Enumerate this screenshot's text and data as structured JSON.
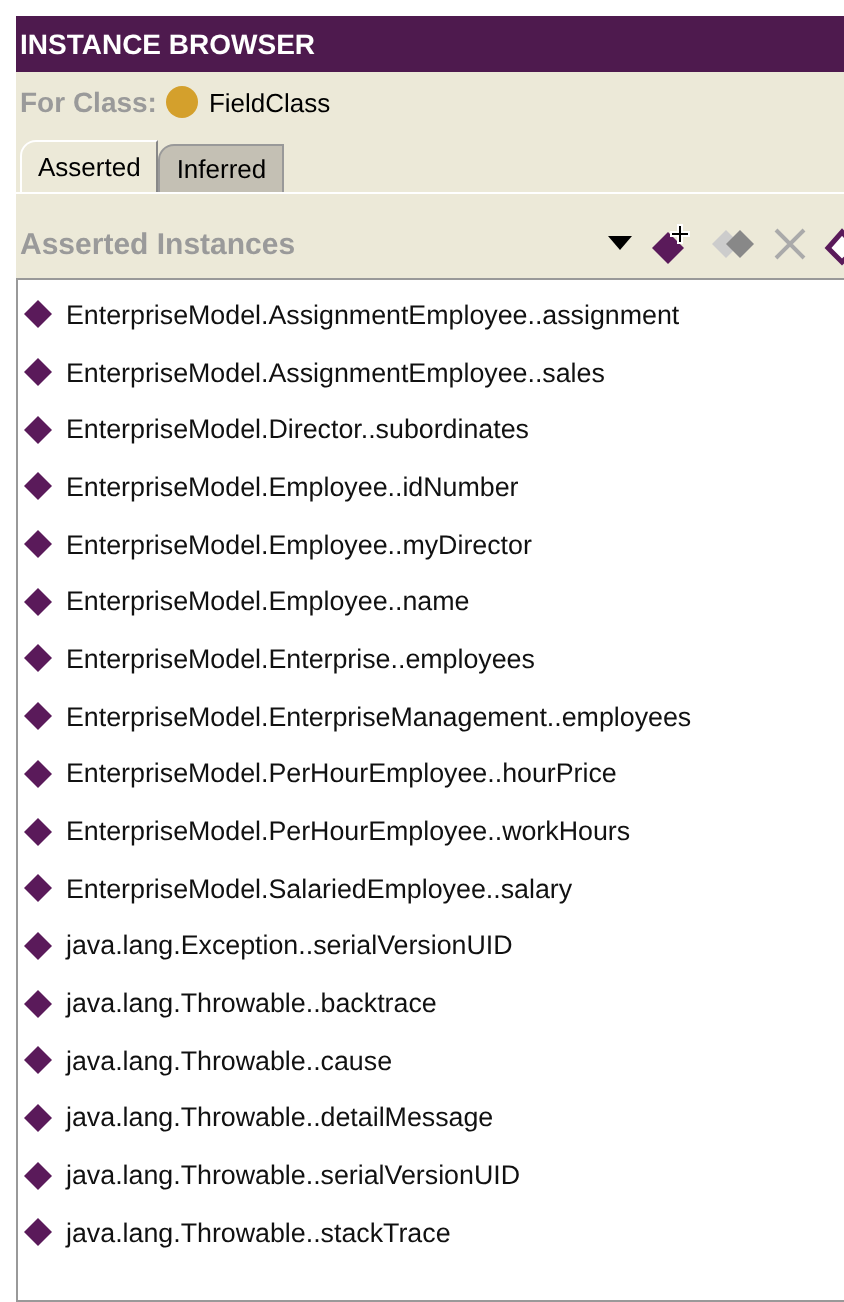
{
  "title": "INSTANCE BROWSER",
  "for_class": {
    "label": "For Class:",
    "value": "FieldClass",
    "color": "#d4a02c"
  },
  "tabs": [
    {
      "label": "Asserted",
      "selected": true
    },
    {
      "label": "Inferred",
      "selected": false
    }
  ],
  "section_title": "Asserted Instances",
  "toolbar": [
    {
      "kind": "dropdown",
      "disabled": false
    },
    {
      "kind": "create",
      "disabled": false
    },
    {
      "kind": "copy",
      "disabled": true
    },
    {
      "kind": "delete",
      "disabled": true
    },
    {
      "kind": "edit",
      "disabled": false
    }
  ],
  "instances": [
    "EnterpriseModel.AssignmentEmployee..assignment",
    "EnterpriseModel.AssignmentEmployee..sales",
    "EnterpriseModel.Director..subordinates",
    "EnterpriseModel.Employee..idNumber",
    "EnterpriseModel.Employee..myDirector",
    "EnterpriseModel.Employee..name",
    "EnterpriseModel.Enterprise..employees",
    "EnterpriseModel.EnterpriseManagement..employees",
    "EnterpriseModel.PerHourEmployee..hourPrice",
    "EnterpriseModel.PerHourEmployee..workHours",
    "EnterpriseModel.SalariedEmployee..salary",
    "java.lang.Exception..serialVersionUID",
    "java.lang.Throwable..backtrace",
    "java.lang.Throwable..cause",
    "java.lang.Throwable..detailMessage",
    "java.lang.Throwable..serialVersionUID",
    "java.lang.Throwable..stackTrace"
  ]
}
